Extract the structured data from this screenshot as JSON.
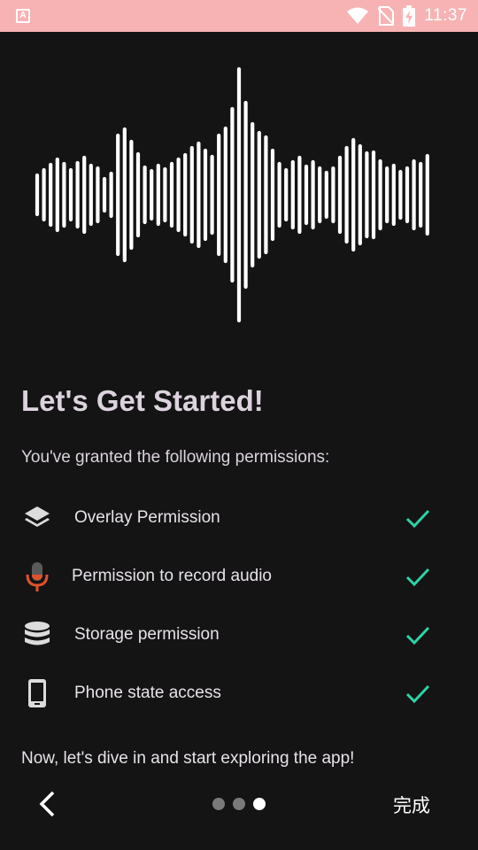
{
  "status_bar": {
    "time": "11:37",
    "app_icon": "notification-app-icon",
    "icons": [
      "wifi-icon",
      "no-sim-icon",
      "battery-charging-icon"
    ],
    "background": "#f7b3b3"
  },
  "hero": {
    "icon": "sound-waveform-graphic"
  },
  "title": "Let's Get Started!",
  "subtitle": "You've granted the following permissions:",
  "permissions": [
    {
      "label": "Overlay Permission",
      "icon": "layers-icon",
      "granted": true
    },
    {
      "label": "Permission to record audio",
      "icon": "microphone-icon",
      "granted": true
    },
    {
      "label": "Storage permission",
      "icon": "database-icon",
      "granted": true
    },
    {
      "label": "Phone state access",
      "icon": "phone-icon",
      "granted": true
    }
  ],
  "outro": "Now, let's dive in and start exploring the app!",
  "nav": {
    "back_icon": "chevron-left-icon",
    "pager_total": 3,
    "pager_active": 3,
    "done_label": "完成"
  },
  "colors": {
    "background": "#141414",
    "text": "#dcd3de",
    "check": "#2ed3a6",
    "mic_accent": "#e2522a"
  }
}
